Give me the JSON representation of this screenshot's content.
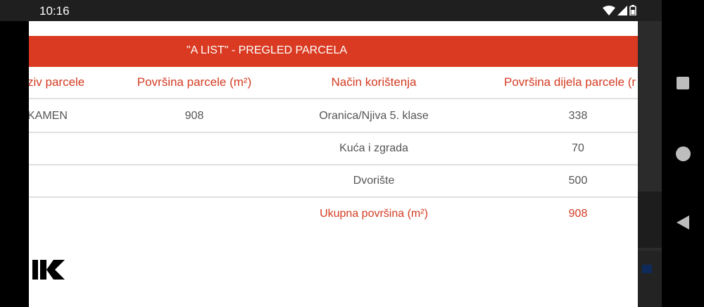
{
  "status_bar": {
    "time": "10:16",
    "icons": [
      "wifi-icon",
      "signal-icon",
      "battery-icon"
    ]
  },
  "table": {
    "title": "\"A LIST\" - PREGLED PARCELA",
    "headers": [
      "ziv parcele",
      "Površina parcele (m²)",
      "Način korištenja",
      "Površina dijela parcele (r"
    ],
    "rows": [
      [
        "KAMEN",
        "908",
        "Oranica/Njiva 5. klase",
        "338"
      ],
      [
        "",
        "",
        "Kuća i zgrada",
        "70"
      ],
      [
        "",
        "",
        "Dvorište",
        "500"
      ]
    ],
    "total": {
      "label": "Ukupna površina (m²)",
      "value": "908"
    }
  },
  "colors": {
    "accent": "#d93a21",
    "header_text": "#d33b22",
    "body_text": "#555555",
    "status_bar": "#1f1f1f"
  },
  "nav_bar": {
    "buttons": [
      "overview-button",
      "home-button",
      "back-button"
    ]
  }
}
